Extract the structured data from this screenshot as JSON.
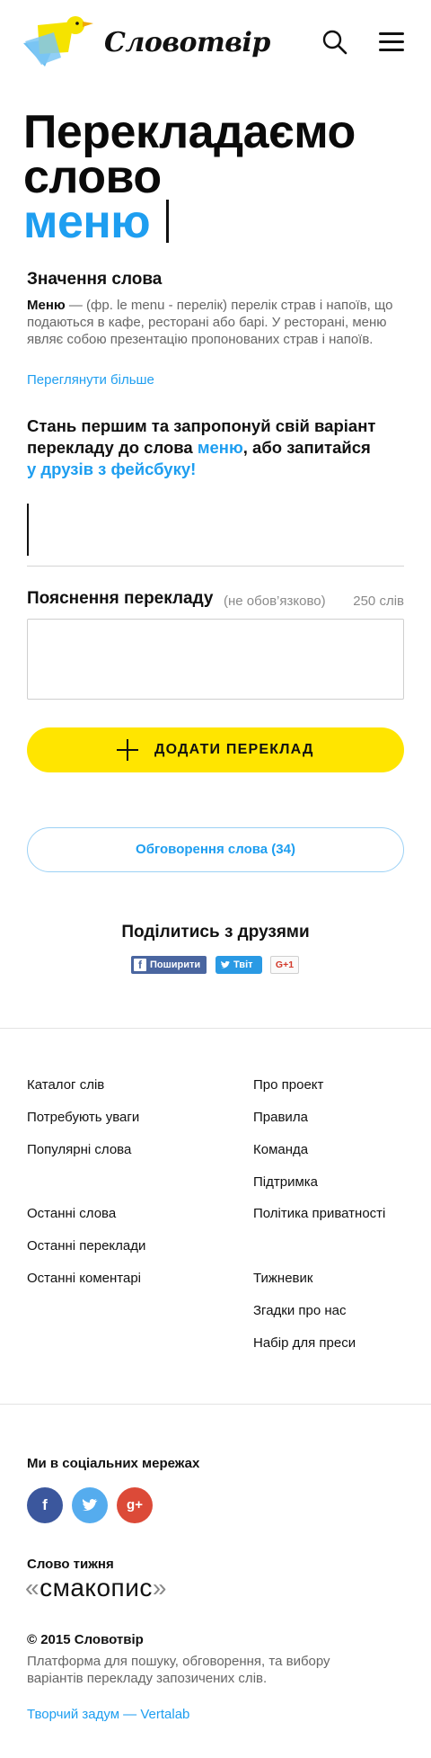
{
  "header": {
    "logo_text": "Словотвір"
  },
  "hero": {
    "title_prefix": "Перекладаємо слово",
    "word": "меню"
  },
  "meaning": {
    "heading": "Значення слова",
    "term": "Меню",
    "definition": " — (фр. le menu - перелік) перелік страв і напоїв, що подаються в кафе, ресторані або барі. У ресторані, меню являє собою презентацію пропонованих страв і напоїв.",
    "more_link": "Переглянути більше"
  },
  "invite": {
    "text_before": "Стань першим та запропонуй свій варіант перекладу до слова ",
    "word_link": "меню",
    "text_middle": ", або запитайся ",
    "friends_link": "у друзів з фейсбуку!"
  },
  "explanation": {
    "label": "Пояснення перекладу",
    "optional": "(не обов’язково)",
    "limit": "250 слів"
  },
  "buttons": {
    "add_translation": "ДОДАТИ ПЕРЕКЛАД",
    "discussion": "Обговорення слова (34)"
  },
  "share": {
    "title": "Поділитись з друзями",
    "facebook": "Поширити",
    "twitter": "Твіт",
    "google": "G+1"
  },
  "footer": {
    "left_links": [
      "Каталог слів",
      "Потребують уваги",
      "Популярні слова",
      "Останні слова",
      "Останні переклади",
      "Останні коментарі"
    ],
    "right_links": [
      "Про проект",
      "Правила",
      "Команда",
      "Підтримка",
      "Політика приватності",
      "Тижневик",
      "Згадки про нас",
      "Набір для преси"
    ]
  },
  "social": {
    "title": "Ми в соціальних мережах",
    "facebook": "f",
    "twitter": "t",
    "google": "g+"
  },
  "word_of_week": {
    "title": "Слово тижня",
    "open_quote": "«",
    "word": "смакопис",
    "close_quote": "»"
  },
  "bottom": {
    "copyright": "© 2015 Словотвір",
    "platform": "Платформа для пошуку, обговорення, та вибору варіантів перекладу запозичених слів.",
    "credit": "Творчий задум — Vertalab"
  },
  "colors": {
    "accent": "#1e9ef0",
    "button_yellow": "#ffe500",
    "logo_yellow": "#f5e300",
    "logo_blue": "#5ab7f0"
  }
}
